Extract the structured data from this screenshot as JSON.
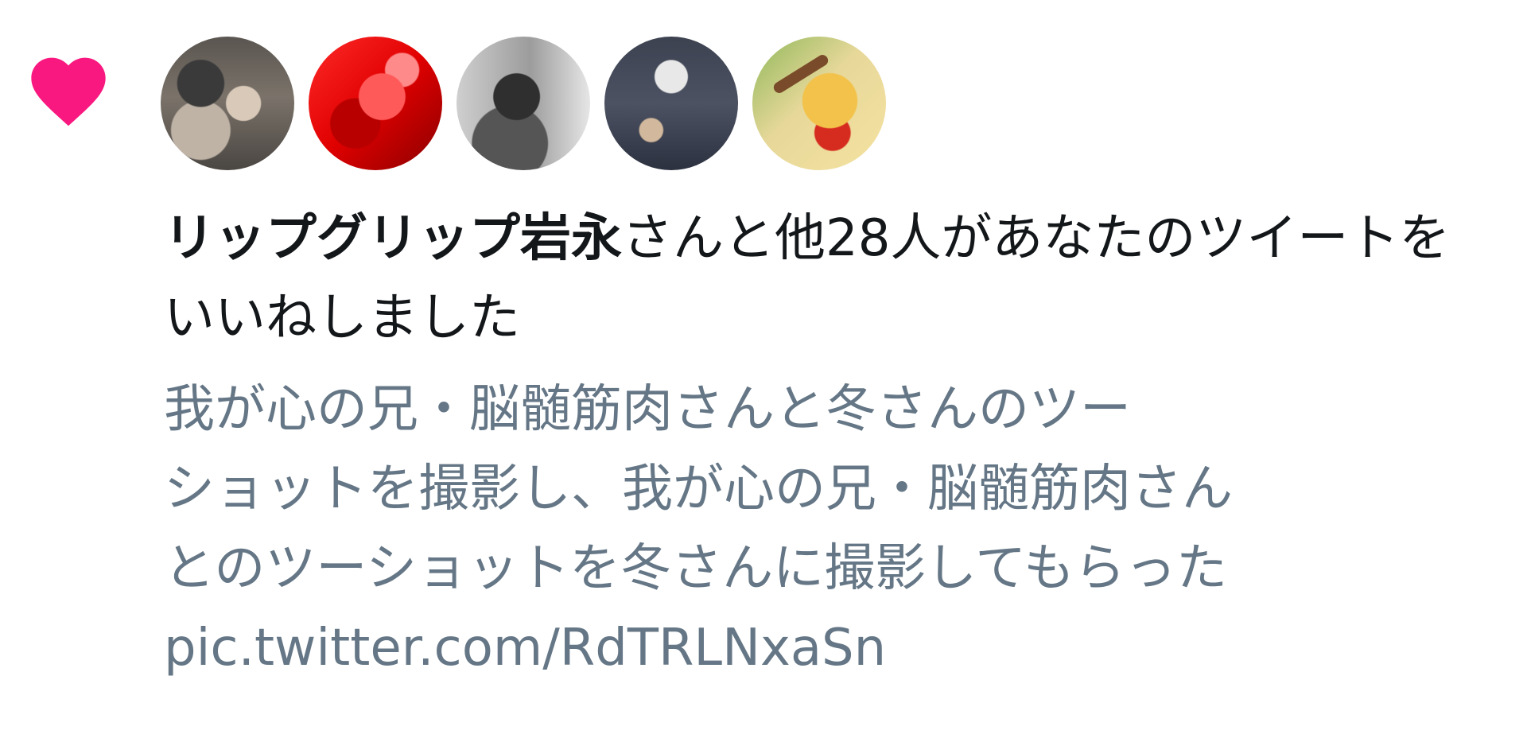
{
  "notification": {
    "type_icon": "heart-icon",
    "icon_color": "#f91880",
    "avatars": [
      {
        "name": "avatar-1"
      },
      {
        "name": "avatar-2"
      },
      {
        "name": "avatar-3"
      },
      {
        "name": "avatar-4"
      },
      {
        "name": "avatar-5"
      }
    ],
    "actor_name": "リップグリップ岩永",
    "action_text": "さんと他28人があなたのツイートをいいねしました",
    "tweet_lines": [
      "我が心の兄・脳髄筋肉さんと冬さんのツー",
      "ショットを撮影し、我が心の兄・脳髄筋肉さん",
      "とのツーショットを冬さんに撮影してもらった",
      "pic.twitter.com/RdTRLNxaSn"
    ]
  }
}
